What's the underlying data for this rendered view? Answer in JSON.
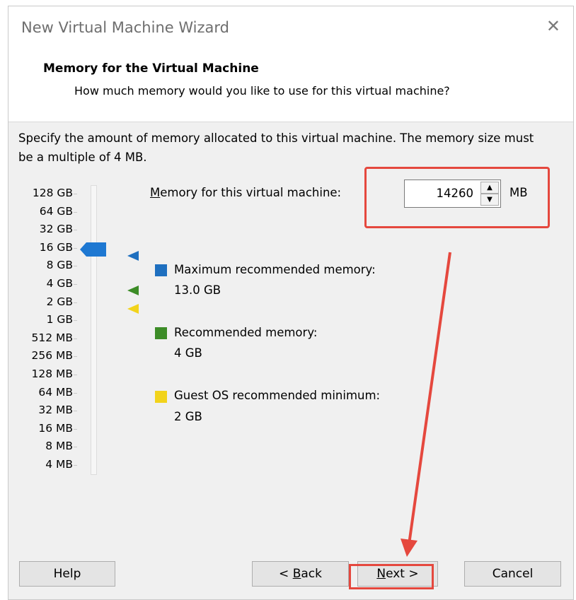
{
  "window": {
    "title": "New Virtual Machine Wizard",
    "close_glyph": "✕"
  },
  "header": {
    "title": "Memory for the Virtual Machine",
    "subtitle": "How much memory would you like to use for this virtual machine?"
  },
  "description": "Specify the amount of memory allocated to this virtual machine. The memory size must be a multiple of 4 MB.",
  "scale": {
    "labels": [
      "128 GB",
      "64 GB",
      "32 GB",
      "16 GB",
      "8 GB",
      "4 GB",
      "2 GB",
      "1 GB",
      "512 MB",
      "256 MB",
      "128 MB",
      "64 MB",
      "32 MB",
      "16 MB",
      "8 MB",
      "4 MB"
    ],
    "current_level": "16 GB"
  },
  "memory": {
    "label_hotkey": "M",
    "label_rest": "emory for this virtual machine:",
    "value": "14260",
    "unit": "MB"
  },
  "legend": [
    {
      "title": "Maximum recommended memory:",
      "value": "13.0 GB",
      "color": "#1e6fbf",
      "level": "16 GB"
    },
    {
      "title": "Recommended memory:",
      "value": "4 GB",
      "color": "#3c8c27",
      "level": "4 GB"
    },
    {
      "title": "Guest OS recommended minimum:",
      "value": "2 GB",
      "color": "#f2d31b",
      "level": "2 GB"
    }
  ],
  "buttons": {
    "help": "Help",
    "back_prefix": "< ",
    "back_hotkey": "B",
    "back_rest": "ack",
    "next_hotkey": "N",
    "next_rest": "ext >",
    "cancel": "Cancel"
  },
  "colors": {
    "accent_annotation": "#e5483e",
    "slider_thumb": "#1e78d2"
  }
}
